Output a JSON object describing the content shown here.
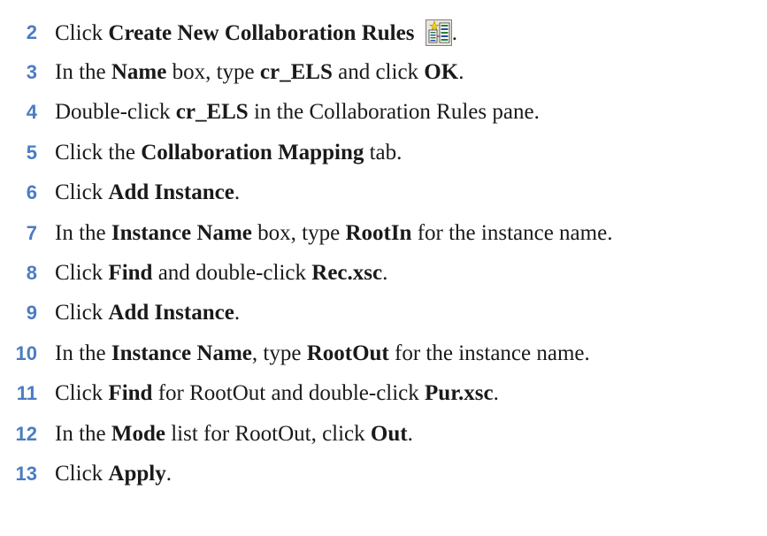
{
  "steps": [
    {
      "number": "2",
      "parts": [
        {
          "text": "Click "
        },
        {
          "text": "Create New Collaboration Rules",
          "bold": true
        },
        {
          "text": " "
        },
        {
          "icon": "create-collaboration-rules-icon"
        },
        {
          "text": "."
        }
      ]
    },
    {
      "number": "3",
      "parts": [
        {
          "text": "In the "
        },
        {
          "text": "Name",
          "bold": true
        },
        {
          "text": " box, type "
        },
        {
          "text": "cr_ELS",
          "bold": true
        },
        {
          "text": " and click "
        },
        {
          "text": "OK",
          "bold": true
        },
        {
          "text": "."
        }
      ]
    },
    {
      "number": "4",
      "parts": [
        {
          "text": "Double-click "
        },
        {
          "text": "cr_ELS",
          "bold": true
        },
        {
          "text": " in the Collaboration Rules pane."
        }
      ]
    },
    {
      "number": "5",
      "parts": [
        {
          "text": "Click the "
        },
        {
          "text": "Collaboration Mapping",
          "bold": true
        },
        {
          "text": " tab."
        }
      ]
    },
    {
      "number": "6",
      "parts": [
        {
          "text": "Click "
        },
        {
          "text": "Add Instance",
          "bold": true
        },
        {
          "text": "."
        }
      ]
    },
    {
      "number": "7",
      "parts": [
        {
          "text": "In the "
        },
        {
          "text": "Instance Name",
          "bold": true
        },
        {
          "text": " box, type "
        },
        {
          "text": "RootIn",
          "bold": true
        },
        {
          "text": " for the instance name."
        }
      ]
    },
    {
      "number": "8",
      "parts": [
        {
          "text": "Click "
        },
        {
          "text": "Find",
          "bold": true
        },
        {
          "text": " and double-click "
        },
        {
          "text": "Rec.xsc",
          "bold": true
        },
        {
          "text": "."
        }
      ]
    },
    {
      "number": "9",
      "parts": [
        {
          "text": "Click "
        },
        {
          "text": "Add Instance",
          "bold": true
        },
        {
          "text": "."
        }
      ]
    },
    {
      "number": "10",
      "parts": [
        {
          "text": "In the "
        },
        {
          "text": "Instance Name",
          "bold": true
        },
        {
          "text": ", type "
        },
        {
          "text": "RootOut",
          "bold": true
        },
        {
          "text": " for the instance name."
        }
      ]
    },
    {
      "number": "11",
      "parts": [
        {
          "text": "Click "
        },
        {
          "text": "Find",
          "bold": true
        },
        {
          "text": " for RootOut and double-click "
        },
        {
          "text": "Pur.xsc",
          "bold": true
        },
        {
          "text": "."
        }
      ]
    },
    {
      "number": "12",
      "parts": [
        {
          "text": "In the "
        },
        {
          "text": "Mode",
          "bold": true
        },
        {
          "text": " list for RootOut, click "
        },
        {
          "text": "Out",
          "bold": true
        },
        {
          "text": "."
        }
      ]
    },
    {
      "number": "13",
      "parts": [
        {
          "text": "Click "
        },
        {
          "text": "Apply",
          "bold": true
        },
        {
          "text": "."
        }
      ]
    }
  ],
  "colors": {
    "step_number": "#4a7cc4",
    "body_text": "#1a1a1a",
    "background": "#ffffff"
  }
}
